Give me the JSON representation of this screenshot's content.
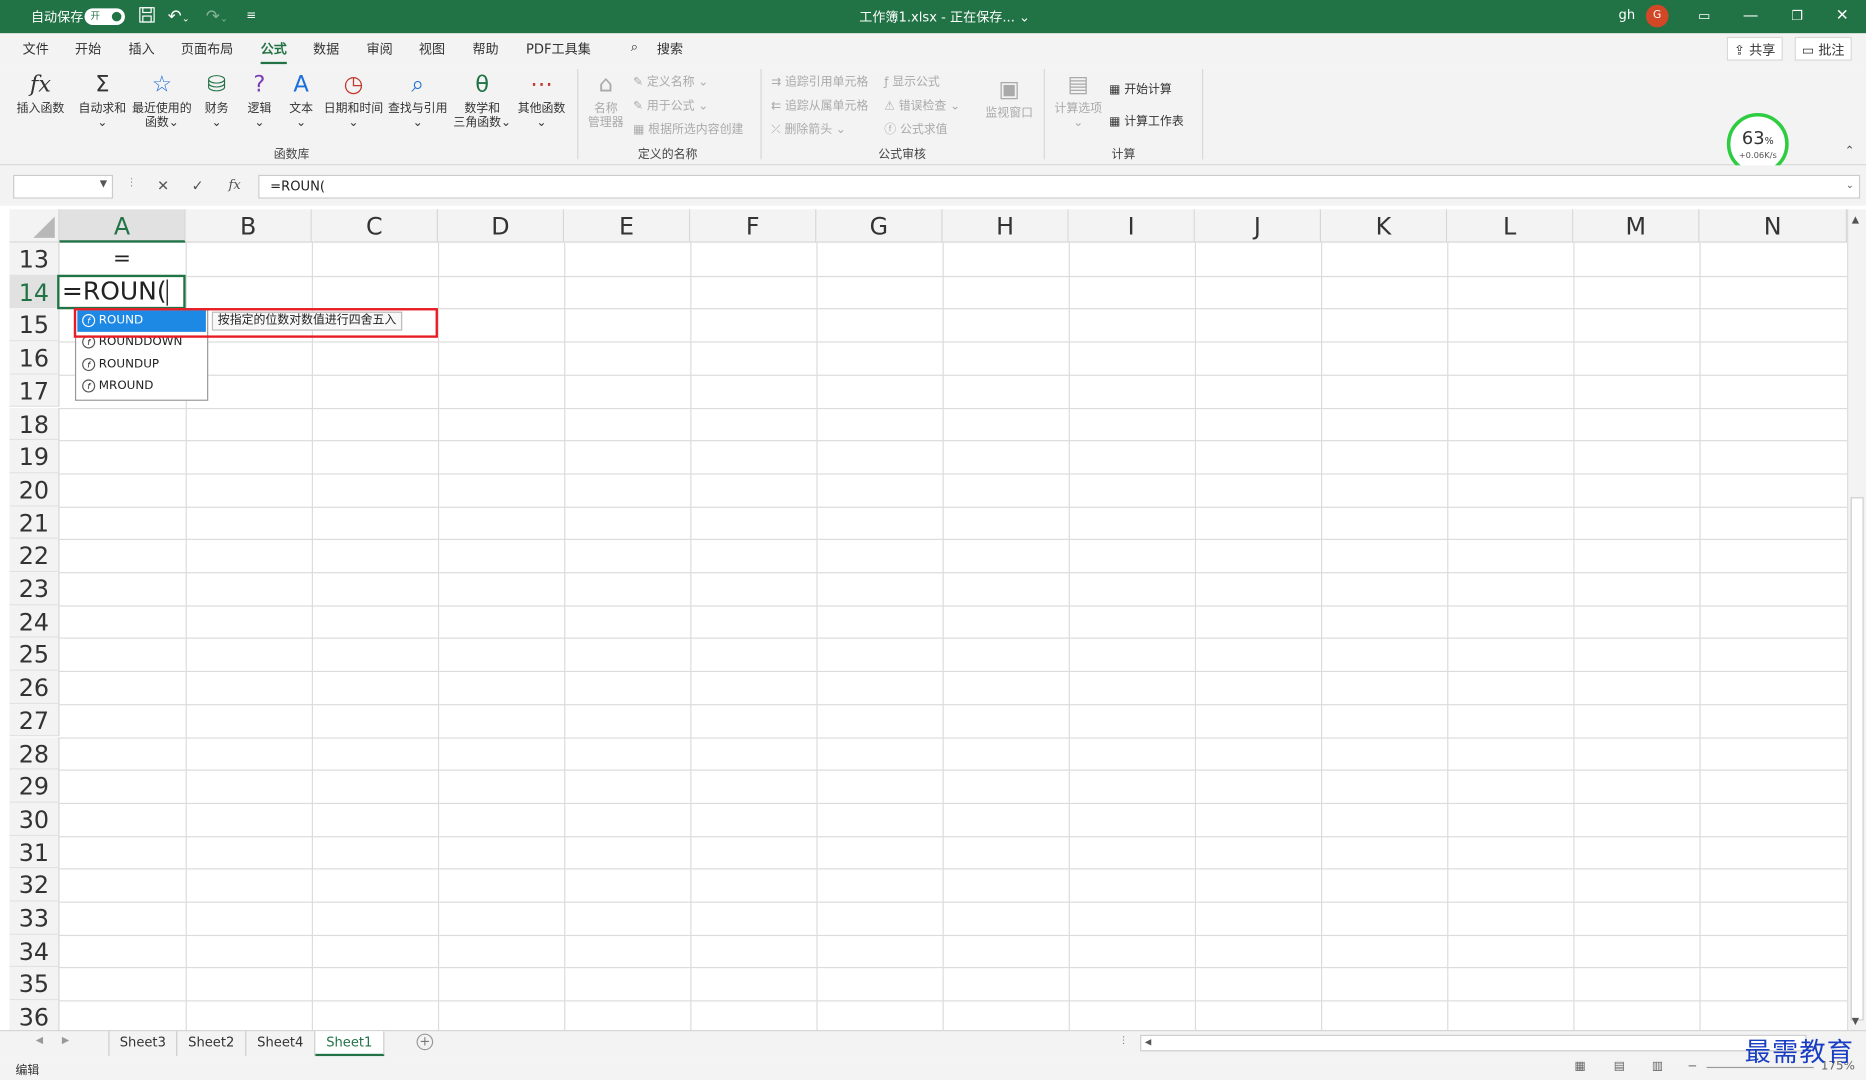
{
  "titlebar": {
    "autosave_label": "自动保存",
    "autosave_state": "开",
    "title": "工作簿1.xlsx - 正在保存... ⌄",
    "user": "gh",
    "avatar": "G"
  },
  "menu": {
    "items": [
      "文件",
      "开始",
      "插入",
      "页面布局",
      "公式",
      "数据",
      "审阅",
      "视图",
      "帮助",
      "PDF工具集"
    ],
    "active": "公式",
    "search": "搜索",
    "share": "共享",
    "comments": "批注"
  },
  "ribbon": {
    "func_library": {
      "insert_function": "插入函数",
      "autosum": "自动求和",
      "recent_1": "最近使用的",
      "recent_2": "函数",
      "financial": "财务",
      "logical": "逻辑",
      "text": "文本",
      "datetime": "日期和时间",
      "lookup": "查找与引用",
      "math_1": "数学和",
      "math_2": "三角函数",
      "more": "其他函数",
      "group_label": "函数库"
    },
    "defined_names": {
      "name_manager_1": "名称",
      "name_manager_2": "管理器",
      "define_name": "定义名称",
      "use_in_formula": "用于公式",
      "create_from_selection": "根据所选内容创建",
      "group_label": "定义的名称"
    },
    "auditing": {
      "trace_precedents": "追踪引用单元格",
      "trace_dependents": "追踪从属单元格",
      "remove_arrows": "删除箭头",
      "show_formulas": "显示公式",
      "error_checking": "错误检查",
      "evaluate_formula": "公式求值",
      "watch_window": "监视窗口",
      "group_label": "公式审核"
    },
    "calculation": {
      "calc_options": "计算选项",
      "calc_now": "开始计算",
      "calc_sheet": "计算工作表",
      "group_label": "计算"
    }
  },
  "perf": {
    "percent": "63",
    "unit": "%",
    "speed": "+0.06K/s"
  },
  "formula_bar": {
    "formula": "=ROUN("
  },
  "grid": {
    "columns": [
      "A",
      "B",
      "C",
      "D",
      "E",
      "F",
      "G",
      "H",
      "I",
      "J",
      "K",
      "L",
      "M",
      "N"
    ],
    "rows": [
      "13",
      "14",
      "15",
      "16",
      "17",
      "18",
      "19",
      "20",
      "21",
      "22",
      "23",
      "24",
      "25",
      "26",
      "27",
      "28",
      "29",
      "30",
      "31",
      "32",
      "33",
      "34",
      "35",
      "36"
    ],
    "cell_a13": "=",
    "active_cell_text": "=ROUN("
  },
  "autocomplete": {
    "items": [
      "ROUND",
      "ROUNDDOWN",
      "ROUNDUP",
      "MROUND"
    ],
    "tooltip": "按指定的位数对数值进行四舍五入"
  },
  "sheets": {
    "tabs": [
      "Sheet3",
      "Sheet2",
      "Sheet4",
      "Sheet1"
    ],
    "active": "Sheet1"
  },
  "status": {
    "mode": "编辑",
    "zoom": "175%"
  },
  "watermark": "最需教育",
  "colors": {
    "excel_green": "#217346",
    "highlight_red": "#e81c24",
    "selection_blue": "#1e88e5"
  }
}
